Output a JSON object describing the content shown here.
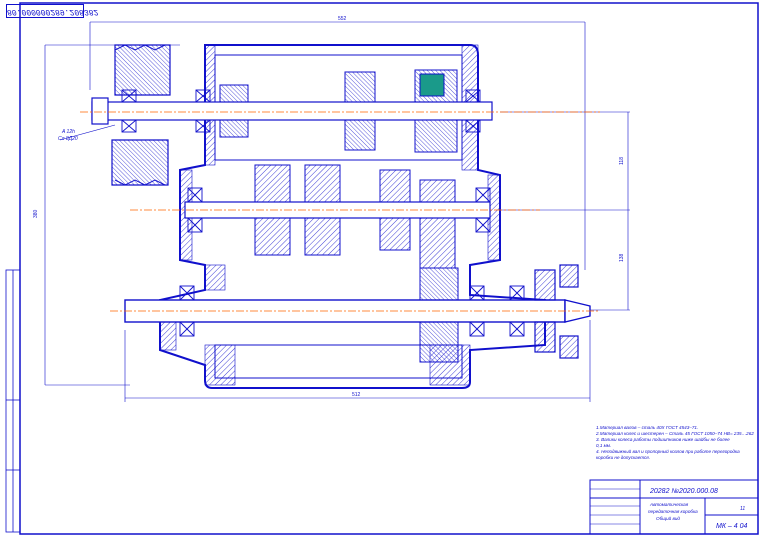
{
  "drawing": {
    "stamp": "80.000000289.208382",
    "dimensions": {
      "overall_width": "552",
      "bottom_width": "512",
      "height_left": "380",
      "right_upper": "118",
      "right_lower": "138"
    },
    "leader_note_line1": "A 12h",
    "leader_note_line2": "Сл 8Д20",
    "notes": [
      "1.Материал валов – сталь 40Х ГОСТ 4543–71.",
      "2.Материал колес и шестерен – Сталь 45 ГОСТ 1050–74 HB= 235…262",
      "3. Валики колеса работы подшипников ниже шайбы не более",
      "0,1 мм.",
      "4. Неподвижный вал и пропорный козлов при работе перегородка коробки не допускается."
    ],
    "title_block": {
      "designation": "20282 №2020.000.08",
      "name_line1": "Автоматическая",
      "name_line2": "передаточная коробка",
      "name_line3": "Общий вид",
      "sheet_info": "11",
      "group": "МК – 4 04"
    }
  },
  "colors": {
    "line": "#1010cc",
    "axis": "#ff6600",
    "hatch": "#1010cc",
    "accent_part": "#1a9a8a"
  }
}
